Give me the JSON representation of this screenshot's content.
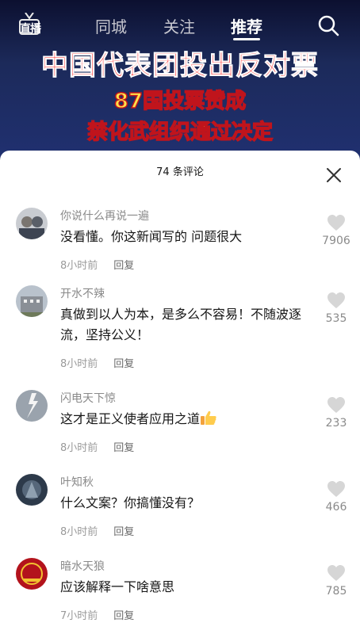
{
  "nav": {
    "live_label": "直播",
    "tabs": [
      "同城",
      "关注",
      "推荐"
    ],
    "active_tab": "推荐"
  },
  "video": {
    "line1": "中国代表团投出反对票",
    "line2": "87国投票赞成",
    "line3": "禁化武组织通过决定"
  },
  "comments_sheet": {
    "title": "74 条评论",
    "reply_label": "回复",
    "comments": [
      {
        "user": "你说什么再说一遍",
        "text": "没看懂。你这新闻写的 问题很大",
        "time": "8小时前",
        "likes": "7906"
      },
      {
        "user": "开水不辣",
        "text": "真做到以人为本，是多么不容易！不随波逐流，坚持公义！",
        "time": "8小时前",
        "likes": "535"
      },
      {
        "user": "闪电天下惊",
        "text": "这才是正义使者应用之道",
        "time": "8小时前",
        "likes": "233"
      },
      {
        "user": "叶知秋",
        "text": "什么文案？你搞懂没有？",
        "time": "8小时前",
        "likes": "466"
      },
      {
        "user": "暗水天狼",
        "text": "应该解释一下啥意思",
        "time": "7小时前",
        "likes": "785"
      }
    ]
  }
}
